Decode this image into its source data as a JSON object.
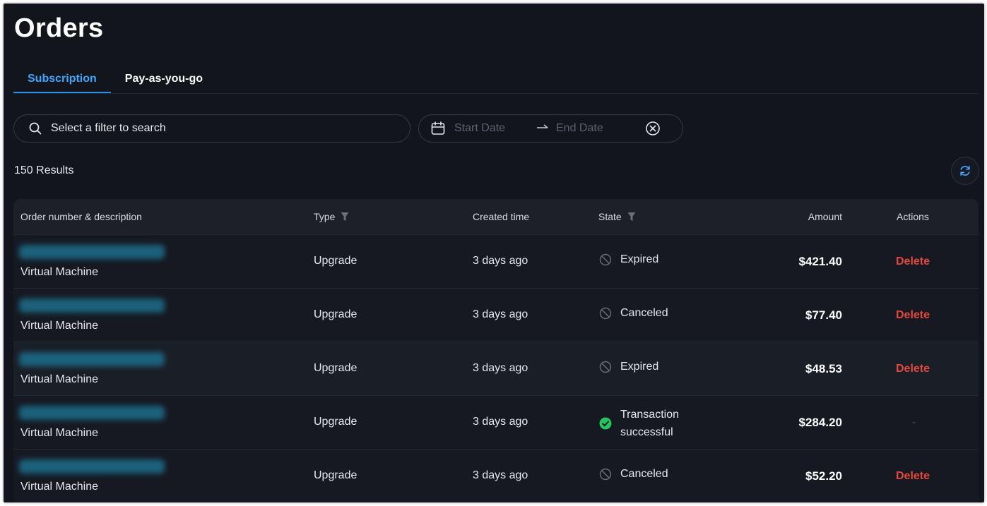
{
  "page": {
    "title": "Orders"
  },
  "tabs": [
    {
      "label": "Subscription",
      "active": true
    },
    {
      "label": "Pay-as-you-go",
      "active": false
    }
  ],
  "search": {
    "placeholder": "Select a filter to search"
  },
  "date_range": {
    "start_placeholder": "Start Date",
    "arrow": "→",
    "end_placeholder": "End Date"
  },
  "results": {
    "label": "150 Results"
  },
  "table": {
    "headers": {
      "order": "Order number & description",
      "type": "Type",
      "created": "Created time",
      "state": "State",
      "amount": "Amount",
      "actions": "Actions"
    },
    "rows": [
      {
        "description": "Virtual Machine",
        "type": "Upgrade",
        "created": "3 days ago",
        "state": "Expired",
        "state_kind": "disabled",
        "amount": "$421.40",
        "action": "Delete"
      },
      {
        "description": "Virtual Machine",
        "type": "Upgrade",
        "created": "3 days ago",
        "state": "Canceled",
        "state_kind": "disabled",
        "amount": "$77.40",
        "action": "Delete"
      },
      {
        "description": "Virtual Machine",
        "type": "Upgrade",
        "created": "3 days ago",
        "state": "Expired",
        "state_kind": "disabled",
        "amount": "$48.53",
        "action": "Delete"
      },
      {
        "description": "Virtual Machine",
        "type": "Upgrade",
        "created": "3 days ago",
        "state_line1": "Transaction",
        "state_line2": "successful",
        "state_kind": "success",
        "amount": "$284.20",
        "action": "-"
      },
      {
        "description": "Virtual Machine",
        "type": "Upgrade",
        "created": "3 days ago",
        "state": "Canceled",
        "state_kind": "disabled",
        "amount": "$52.20",
        "action": "Delete"
      }
    ]
  },
  "colors": {
    "background": "#13151c",
    "accent": "#3ea6ff",
    "danger": "#e5483e",
    "success": "#22c55e"
  },
  "icons": {
    "search": "search-icon",
    "calendar": "calendar-icon",
    "clear": "clear-circle-icon",
    "refresh": "refresh-icon",
    "filter": "filter-icon",
    "disabled": "ban-icon",
    "success": "check-circle-icon"
  }
}
